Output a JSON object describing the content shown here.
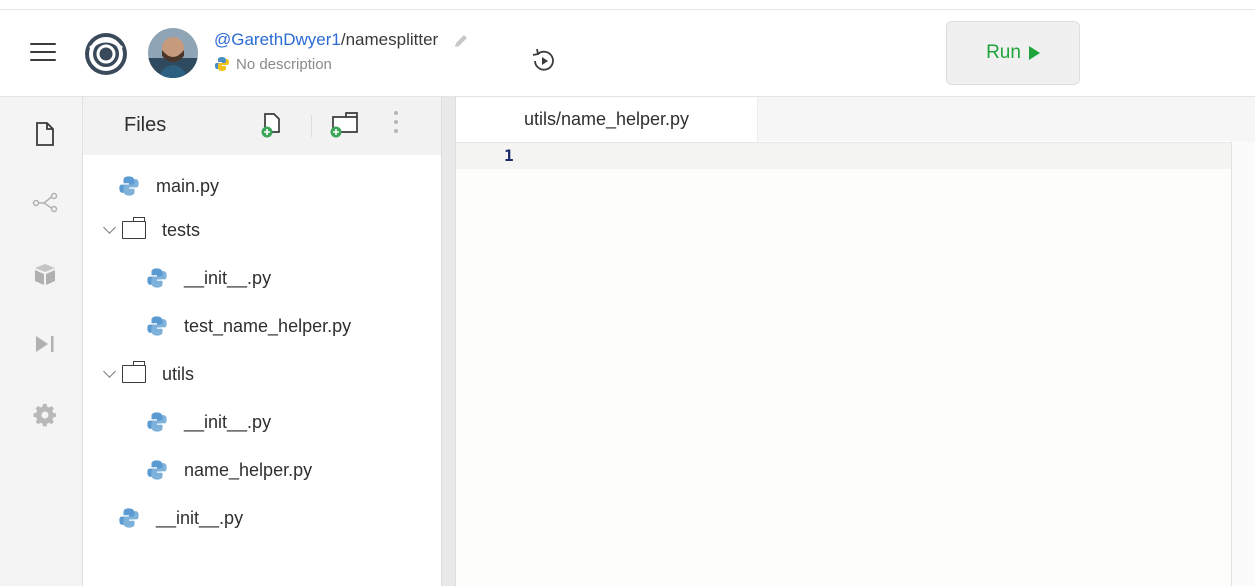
{
  "header": {
    "username": "@GarethDwyer1",
    "separator": "/",
    "repl_name": "namesplitter",
    "description": "No description",
    "run_label": "Run"
  },
  "files_panel": {
    "title": "Files"
  },
  "tree": [
    {
      "type": "file",
      "label": "main.py"
    },
    {
      "type": "folder",
      "label": "tests"
    },
    {
      "type": "file",
      "label": "__init__.py"
    },
    {
      "type": "file",
      "label": "test_name_helper.py"
    },
    {
      "type": "folder",
      "label": "utils"
    },
    {
      "type": "file",
      "label": "__init__.py"
    },
    {
      "type": "file",
      "label": "name_helper.py"
    },
    {
      "type": "file",
      "label": "__init__.py"
    }
  ],
  "editor": {
    "tab_label": "utils/name_helper.py",
    "line_number": "1"
  },
  "colors": {
    "accent_blue": "#2b6bd6",
    "run_green": "#1fa43b",
    "python_blue": "#4a8ec6",
    "python_yellow": "#f2c21b"
  }
}
